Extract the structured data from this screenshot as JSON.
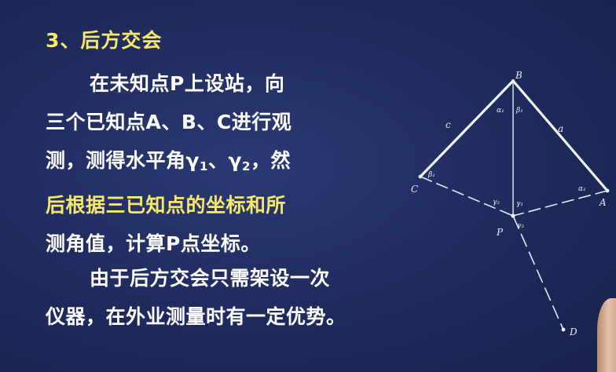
{
  "slide": {
    "title": "3、后方交会",
    "paragraph1": {
      "line1": "在未知点P上设站，向",
      "line2": "三个已知点A、B、C进行观",
      "line3_a": "测，测得水平角γ",
      "line3_sub1": "1",
      "line3_b": "、γ",
      "line3_sub2": "2",
      "line3_c": "，然",
      "line4": "后根据三已知点的坐标和所",
      "line5": "测角值，计算P点坐标。"
    },
    "paragraph2": {
      "line1": "由于后方交会只需架设一次",
      "line2": "仪器，在外业测量时有一定优势。"
    }
  },
  "figure": {
    "points": {
      "A": "A",
      "B": "B",
      "C": "C",
      "P": "P",
      "D": "D"
    },
    "sides": {
      "a": "a",
      "c": "c"
    },
    "angles": {
      "alpha_at_B": "α₁",
      "beta_at_B": "β₁",
      "beta_at_C": "β₁",
      "alpha_at_A": "α₁",
      "gamma_left": "γ₂",
      "gamma_right": "γ₁",
      "gamma_below": "γ₃"
    }
  }
}
